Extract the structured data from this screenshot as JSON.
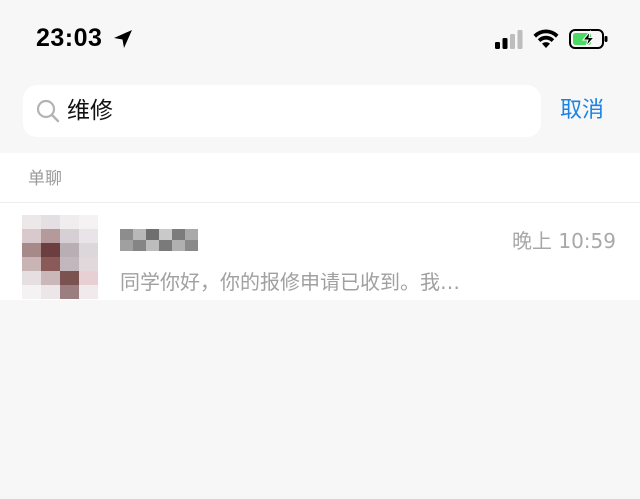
{
  "status_bar": {
    "time": "23:03",
    "icons": [
      "location-arrow-icon",
      "cellular-signal-icon",
      "wifi-icon",
      "battery-charging-icon"
    ],
    "battery_color": "#4cd964"
  },
  "search": {
    "value": "维修",
    "icon": "search-icon",
    "cancel_label": "取消"
  },
  "sections": [
    {
      "title": "单聊",
      "results": [
        {
          "name_pixelated": true,
          "time": "晚上 10:59",
          "preview": "同学你好，你的报修申请已收到。我…"
        }
      ]
    }
  ],
  "colors": {
    "accent": "#1a83e6",
    "background": "#f7f7f7",
    "secondary_text": "#a0a0a0"
  }
}
